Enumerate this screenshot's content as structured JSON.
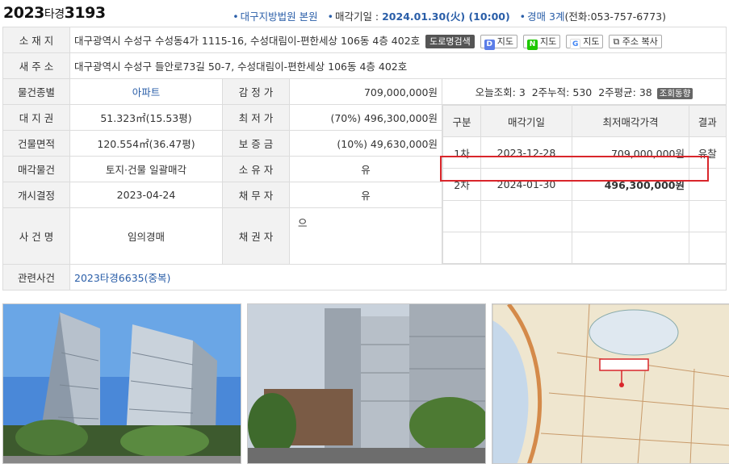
{
  "header": {
    "case_number_prefix": "2023",
    "case_type": "타경",
    "case_number_suffix": "3193",
    "court": "대구지방법원 본원",
    "auction_date_label": "매각기일 :",
    "auction_date": "2024.01.30(火) (10:00)",
    "department": "경매 3계",
    "phone": "(전화:053-757-6773)"
  },
  "location": {
    "label": "소 재 지",
    "address": "대구광역시 수성구 수성동4가 1115-16, 수성대림이-편한세상 106동 4층 402호",
    "road_search_btn": "도로명검색",
    "daum_map_btn": "지도",
    "naver_map_btn": "지도",
    "google_map_btn": "지도",
    "copy_btn": "주소 복사"
  },
  "new_address": {
    "label": "새 주 소",
    "value": "대구광역시 수성구 들안로73길 50-7, 수성대림이-편한세상 106동 4층 402호"
  },
  "details": {
    "type_label": "물건종별",
    "type_value": "아파트",
    "appraisal_label": "감 정 가",
    "appraisal_value": "709,000,000원",
    "land_label": "대 지 권",
    "land_value": "51.323㎡(15.53평)",
    "min_price_label": "최 저 가",
    "min_price_value": "(70%) 496,300,000원",
    "building_label": "건물면적",
    "building_value": "120.554㎡(36.47평)",
    "deposit_label": "보 증 금",
    "deposit_value": "(10%) 49,630,000원",
    "sale_item_label": "매각물건",
    "sale_item_value": "토지·건물 일괄매각",
    "owner_label": "소 유 자",
    "owner_value": "유",
    "start_label": "개시결정",
    "start_value": "2023-04-24",
    "debtor_label": "채 무 자",
    "debtor_value": "유",
    "case_name_label": "사 건 명",
    "case_name_value": "임의경매",
    "creditor_label": "채 권 자",
    "creditor_value": "으",
    "related_label": "관련사건",
    "related_value": "2023타경6635(중복)"
  },
  "stats": {
    "today_views": "오늘조회: 3",
    "two_week_total": "2주누적: 530",
    "two_week_avg": "2주평균: 38",
    "trend_btn": "조회동향"
  },
  "sale_history": {
    "headers": [
      "구분",
      "매각기일",
      "최저매각가격",
      "결과"
    ],
    "rows": [
      {
        "round": "1차",
        "date": "2023-12-28",
        "price": "709,000,000원",
        "result": "유찰"
      },
      {
        "round": "2차",
        "date": "2024-01-30",
        "price": "496,300,000원",
        "result": ""
      }
    ]
  },
  "colors": {
    "link": "#2a5ea8",
    "highlight": "#d9262b",
    "label_bg": "#f2f2f2"
  }
}
